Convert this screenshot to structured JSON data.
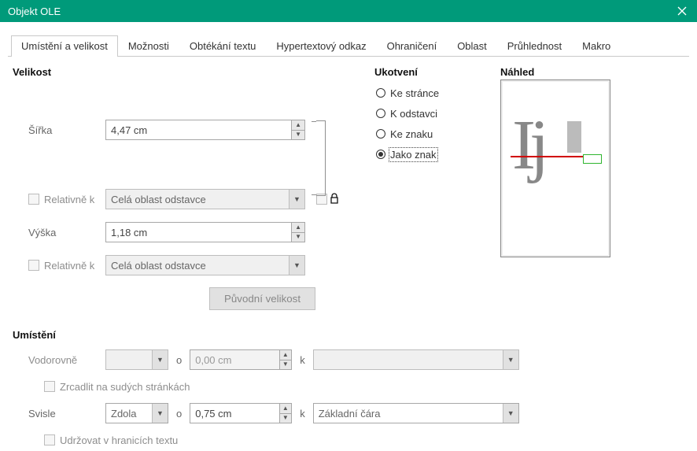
{
  "window": {
    "title": "Objekt OLE"
  },
  "tabs": [
    "Umístění a velikost",
    "Možnosti",
    "Obtékání textu",
    "Hypertextový odkaz",
    "Ohraničení",
    "Oblast",
    "Průhlednost",
    "Makro"
  ],
  "active_tab": 0,
  "size": {
    "heading": "Velikost",
    "width_label": "Šířka",
    "width_value": "4,47 cm",
    "rel_width_label": "Relativně k",
    "rel_width_combo": "Celá oblast odstavce",
    "height_label": "Výška",
    "height_value": "1,18 cm",
    "rel_height_label": "Relativně k",
    "rel_height_combo": "Celá oblast odstavce",
    "original_btn": "Původní velikost"
  },
  "anchor": {
    "heading": "Ukotvení",
    "options": [
      "Ke stránce",
      "K odstavci",
      "Ke znaku",
      "Jako znak"
    ],
    "selected": 3
  },
  "preview": {
    "heading": "Náhled"
  },
  "position": {
    "heading": "Umístění",
    "horiz_label": "Vodorovně",
    "horiz_at_label": "o",
    "horiz_at_value": "0,00 cm",
    "horiz_to_label": "k",
    "horiz_to_combo": "",
    "mirror_label": "Zrcadlit na sudých stránkách",
    "vert_label": "Svisle",
    "vert_from_combo": "Zdola",
    "vert_at_label": "o",
    "vert_at_value": "0,75 cm",
    "vert_to_label": "k",
    "vert_to_combo": "Základní čára",
    "keep_inside_label": "Udržovat v hranicích textu"
  }
}
